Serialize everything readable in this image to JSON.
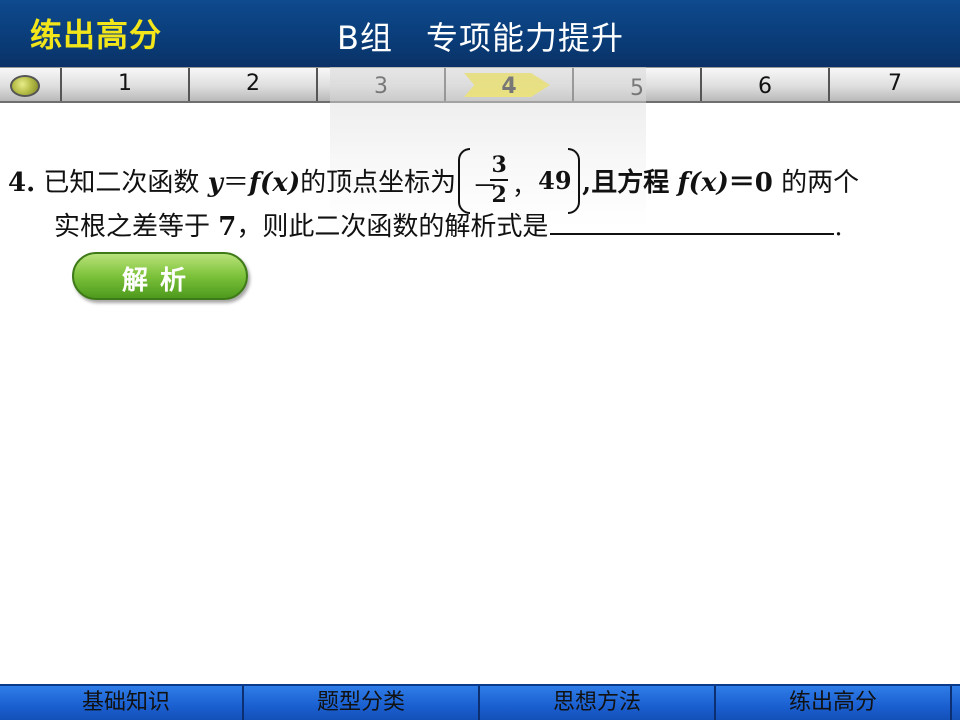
{
  "header": {
    "left_title": "练出高分",
    "center_title": "B组　专项能力提升"
  },
  "tabs": [
    {
      "label": "1",
      "active": false
    },
    {
      "label": "2",
      "active": false
    },
    {
      "label": "3",
      "active": false
    },
    {
      "label": "4",
      "active": true
    },
    {
      "label": "5",
      "active": false
    },
    {
      "label": "6",
      "active": false
    },
    {
      "label": "7",
      "active": false
    }
  ],
  "question": {
    "number": "4",
    "sep": ".",
    "text_a": "已知二次函数",
    "expr_y": "y",
    "eq": "＝",
    "expr_fx": "f",
    "paren_x": "(x)",
    "text_b": "的顶点坐标为",
    "vertex_minus": "－",
    "vertex_num": "3",
    "vertex_den": "2",
    "vertex_comma": "，",
    "vertex_y": "49",
    "text_c": ",且方程",
    "eq_zero": "＝0",
    "text_d": "的两个",
    "line2_a": "实根之差等于",
    "line2_num": "7",
    "line2_b": "，则此二次函数的解析式是",
    "line2_end": "."
  },
  "analysis_button": "解析",
  "bottom_nav": [
    "基础知识",
    "题型分类",
    "思想方法",
    "练出高分"
  ],
  "colors": {
    "header_bg": "#0a3c78",
    "header_accent": "#f2e51a",
    "active_tab": "#f7e62b",
    "button_green": "#7cc23a",
    "bottom_nav_bg": "#1a5fd0"
  }
}
